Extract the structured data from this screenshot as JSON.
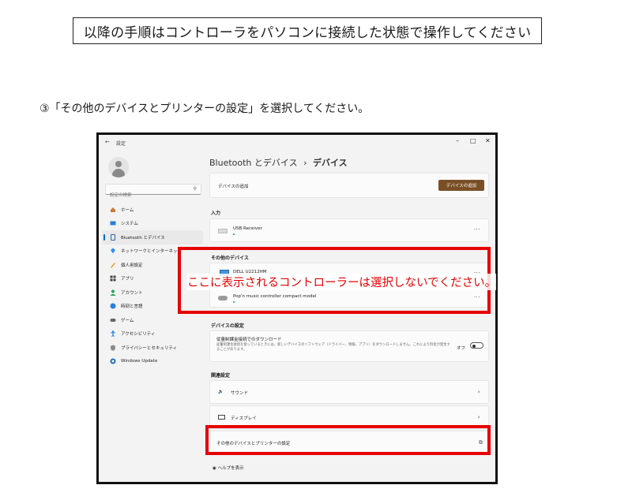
{
  "instruction_banner": "以降の手順はコントローラをパソコンに接続した状態で操作してください",
  "step_text": "③「その他のデバイスとプリンターの設定」を選択してください。",
  "annotation_text": "ここに表示されるコントローラーは選択しないでください。",
  "settings_window": {
    "back_arrow": "←",
    "app_title": "設定",
    "window_controls": {
      "minimize": "–",
      "maximize": "□",
      "close": "✕"
    },
    "search_placeholder": "設定の検索",
    "nav_items": [
      {
        "label": "ホーム",
        "icon": "home-icon"
      },
      {
        "label": "システム",
        "icon": "system-icon"
      },
      {
        "label": "Bluetooth とデバイス",
        "icon": "bluetooth-icon",
        "active": true
      },
      {
        "label": "ネットワークとインターネット",
        "icon": "network-icon"
      },
      {
        "label": "個人用設定",
        "icon": "brush-icon"
      },
      {
        "label": "アプリ",
        "icon": "apps-icon"
      },
      {
        "label": "アカウント",
        "icon": "account-icon"
      },
      {
        "label": "時刻と言語",
        "icon": "globe-clock-icon"
      },
      {
        "label": "ゲーム",
        "icon": "gamepad-icon"
      },
      {
        "label": "アクセシビリティ",
        "icon": "accessibility-icon"
      },
      {
        "label": "プライバシーとセキュリティ",
        "icon": "shield-icon"
      },
      {
        "label": "Windows Update",
        "icon": "update-icon"
      }
    ],
    "breadcrumb": {
      "parent": "Bluetooth とデバイス",
      "separator": "›",
      "current": "デバイス"
    },
    "add_device": {
      "label": "デバイスの追加",
      "button": "デバイスの追加"
    },
    "input_section": {
      "heading": "入力",
      "device": "USB Receiver"
    },
    "other_devices": {
      "heading": "その他のデバイス",
      "devices": [
        "DELL U2212HM",
        "Pop'n music controller compact model"
      ]
    },
    "device_settings": {
      "heading": "デバイスの設定",
      "metered_title": "従量制課金接続でのダウンロード",
      "metered_desc": "従量制課金接続を使っているときには、新しいデバイスのソフトウェア（ドライバー、情報、アプリ）をダウンロードしません。これにより料金が発生することがあります。",
      "toggle_label": "オフ"
    },
    "related": {
      "heading": "関連設定",
      "items": [
        "サウンド",
        "ディスプレイ",
        "その他のデバイスとプリンターの設定"
      ]
    },
    "help": "ヘルプを表示",
    "more_label": "···",
    "chevron": "›",
    "external_icon": "⧉"
  },
  "colors": {
    "highlight_red": "#e60000",
    "accent_button": "#7a4f26",
    "nav_indicator": "#0067c0"
  }
}
